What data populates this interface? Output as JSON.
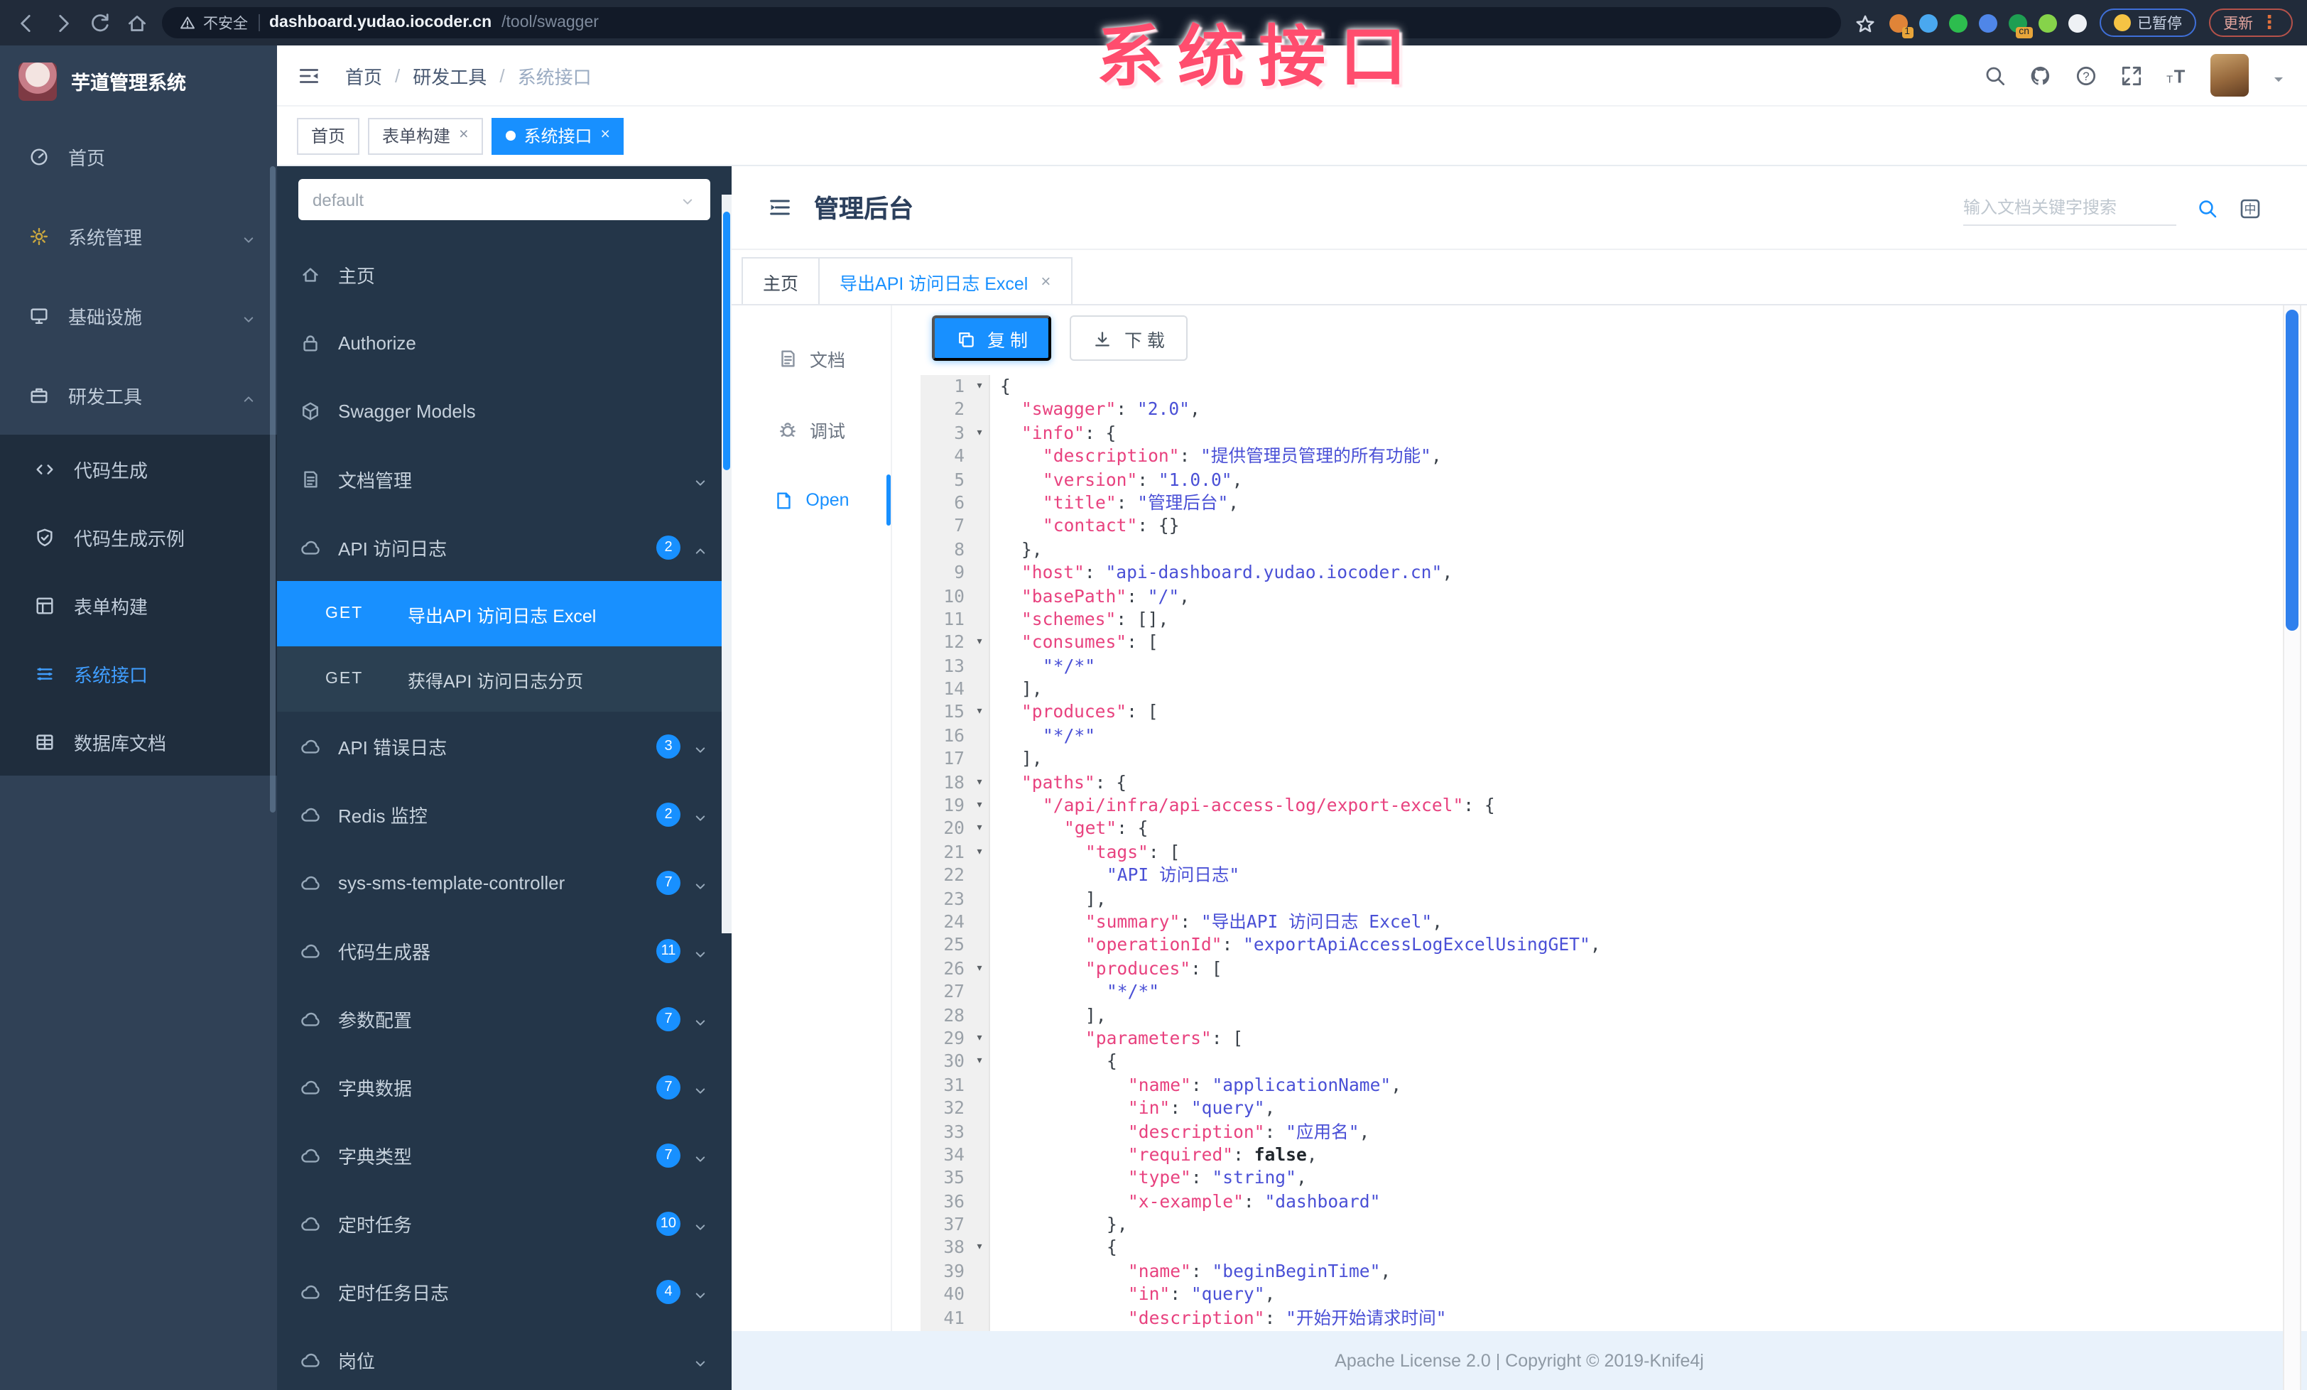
{
  "browser": {
    "security_label": "不安全",
    "url_host": "dashboard.yudao.iocoder.cn",
    "url_path": "/tool/swagger",
    "extensions": [
      {
        "color": "#e08438",
        "badge": "1"
      },
      {
        "color": "#4aa8ef",
        "badge": ""
      },
      {
        "color": "#2dbd4e",
        "badge": ""
      },
      {
        "color": "#4f86e8",
        "badge": ""
      },
      {
        "color": "#1e9e52",
        "badge": "cn"
      },
      {
        "color": "#86d34a",
        "badge": ""
      },
      {
        "color": "#eef1f5",
        "badge": ""
      }
    ],
    "paused_badge": "已暂停",
    "update_button": "更新",
    "overlay_title": "系统接口"
  },
  "app": {
    "logo_title": "芋道管理系统",
    "breadcrumb": [
      "首页",
      "研发工具",
      "系统接口"
    ],
    "sidebar_items": [
      {
        "icon": "dashboard",
        "label": "首页"
      },
      {
        "icon": "gear",
        "label": "系统管理",
        "chevron": "down",
        "icon_color": "#c9a63f"
      },
      {
        "icon": "infra",
        "label": "基础设施",
        "chevron": "down"
      },
      {
        "icon": "tool",
        "label": "研发工具",
        "chevron": "up",
        "expanded": true,
        "children": [
          {
            "icon": "code",
            "label": "代码生成"
          },
          {
            "icon": "shield",
            "label": "代码生成示例"
          },
          {
            "icon": "form",
            "label": "表单构建"
          },
          {
            "icon": "swagger",
            "label": "系统接口",
            "active": true
          },
          {
            "icon": "db",
            "label": "数据库文档"
          }
        ]
      }
    ],
    "tags": [
      {
        "label": "首页",
        "closable": false,
        "active": false
      },
      {
        "label": "表单构建",
        "closable": true,
        "active": false
      },
      {
        "label": "系统接口",
        "closable": true,
        "active": true
      }
    ]
  },
  "swagger_panel": {
    "group_select": "default",
    "items": [
      {
        "type": "link",
        "icon": "home",
        "label": "主页"
      },
      {
        "type": "link",
        "icon": "lock",
        "label": "Authorize"
      },
      {
        "type": "link",
        "icon": "cube",
        "label": "Swagger Models"
      },
      {
        "type": "group",
        "icon": "docfile",
        "label": "文档管理",
        "badge": "",
        "chevron": "down"
      },
      {
        "type": "group",
        "icon": "cloud",
        "label": "API 访问日志",
        "badge": "2",
        "chevron": "up",
        "expanded": true,
        "children": [
          {
            "method": "GET",
            "label": "导出API 访问日志 Excel",
            "active": true
          },
          {
            "method": "GET",
            "label": "获得API 访问日志分页",
            "active": false
          }
        ]
      },
      {
        "type": "group",
        "icon": "cloud",
        "label": "API 错误日志",
        "badge": "3",
        "chevron": "down"
      },
      {
        "type": "group",
        "icon": "cloud",
        "label": "Redis 监控",
        "badge": "2",
        "chevron": "down"
      },
      {
        "type": "group",
        "icon": "cloud",
        "label": "sys-sms-template-controller",
        "badge": "7",
        "chevron": "down"
      },
      {
        "type": "group",
        "icon": "cloud",
        "label": "代码生成器",
        "badge": "11",
        "chevron": "down"
      },
      {
        "type": "group",
        "icon": "cloud",
        "label": "参数配置",
        "badge": "7",
        "chevron": "down"
      },
      {
        "type": "group",
        "icon": "cloud",
        "label": "字典数据",
        "badge": "7",
        "chevron": "down"
      },
      {
        "type": "group",
        "icon": "cloud",
        "label": "字典类型",
        "badge": "7",
        "chevron": "down"
      },
      {
        "type": "group",
        "icon": "cloud",
        "label": "定时任务",
        "badge": "10",
        "chevron": "down"
      },
      {
        "type": "group",
        "icon": "cloud",
        "label": "定时任务日志",
        "badge": "4",
        "chevron": "down"
      },
      {
        "type": "group",
        "icon": "cloud",
        "label": "岗位",
        "badge": "",
        "chevron": "down"
      }
    ]
  },
  "content": {
    "title": "管理后台",
    "search_placeholder": "输入文档关键字搜索",
    "lang_label": "中",
    "doc_tabs": [
      {
        "label": "主页",
        "closable": false,
        "active": false
      },
      {
        "label": "导出API 访问日志 Excel",
        "closable": true,
        "active": true
      }
    ],
    "side_tabs": [
      {
        "icon": "docfile",
        "label": "文档",
        "active": false
      },
      {
        "icon": "bug",
        "label": "调试",
        "active": false
      },
      {
        "icon": "file",
        "label": "Open",
        "active": true
      }
    ],
    "copy_button": "复 制",
    "download_button": "下 载",
    "footer": "Apache License 2.0 | Copyright © 2019-Knife4j"
  },
  "code": {
    "lines": [
      {
        "n": 1,
        "fold": true,
        "ind": 0,
        "t": [
          [
            "p",
            "{"
          ]
        ]
      },
      {
        "n": 2,
        "fold": false,
        "ind": 1,
        "t": [
          [
            "k",
            "\"swagger\""
          ],
          [
            "p",
            ": "
          ],
          [
            "s",
            "\"2.0\""
          ],
          [
            "p",
            ","
          ]
        ]
      },
      {
        "n": 3,
        "fold": true,
        "ind": 1,
        "t": [
          [
            "k",
            "\"info\""
          ],
          [
            "p",
            ": {"
          ]
        ]
      },
      {
        "n": 4,
        "fold": false,
        "ind": 2,
        "t": [
          [
            "k",
            "\"description\""
          ],
          [
            "p",
            ": "
          ],
          [
            "s",
            "\"提供管理员管理的所有功能\""
          ],
          [
            "p",
            ","
          ]
        ]
      },
      {
        "n": 5,
        "fold": false,
        "ind": 2,
        "t": [
          [
            "k",
            "\"version\""
          ],
          [
            "p",
            ": "
          ],
          [
            "s",
            "\"1.0.0\""
          ],
          [
            "p",
            ","
          ]
        ]
      },
      {
        "n": 6,
        "fold": false,
        "ind": 2,
        "t": [
          [
            "k",
            "\"title\""
          ],
          [
            "p",
            ": "
          ],
          [
            "s",
            "\"管理后台\""
          ],
          [
            "p",
            ","
          ]
        ]
      },
      {
        "n": 7,
        "fold": false,
        "ind": 2,
        "t": [
          [
            "k",
            "\"contact\""
          ],
          [
            "p",
            ": {}"
          ]
        ]
      },
      {
        "n": 8,
        "fold": false,
        "ind": 1,
        "t": [
          [
            "p",
            "},"
          ]
        ]
      },
      {
        "n": 9,
        "fold": false,
        "ind": 1,
        "t": [
          [
            "k",
            "\"host\""
          ],
          [
            "p",
            ": "
          ],
          [
            "s",
            "\"api-dashboard.yudao.iocoder.cn\""
          ],
          [
            "p",
            ","
          ]
        ]
      },
      {
        "n": 10,
        "fold": false,
        "ind": 1,
        "t": [
          [
            "k",
            "\"basePath\""
          ],
          [
            "p",
            ": "
          ],
          [
            "s",
            "\"/\""
          ],
          [
            "p",
            ","
          ]
        ]
      },
      {
        "n": 11,
        "fold": false,
        "ind": 1,
        "t": [
          [
            "k",
            "\"schemes\""
          ],
          [
            "p",
            ": [],"
          ]
        ]
      },
      {
        "n": 12,
        "fold": true,
        "ind": 1,
        "t": [
          [
            "k",
            "\"consumes\""
          ],
          [
            "p",
            ": ["
          ]
        ]
      },
      {
        "n": 13,
        "fold": false,
        "ind": 2,
        "t": [
          [
            "s",
            "\"*/*\""
          ]
        ]
      },
      {
        "n": 14,
        "fold": false,
        "ind": 1,
        "t": [
          [
            "p",
            "],"
          ]
        ]
      },
      {
        "n": 15,
        "fold": true,
        "ind": 1,
        "t": [
          [
            "k",
            "\"produces\""
          ],
          [
            "p",
            ": ["
          ]
        ]
      },
      {
        "n": 16,
        "fold": false,
        "ind": 2,
        "t": [
          [
            "s",
            "\"*/*\""
          ]
        ]
      },
      {
        "n": 17,
        "fold": false,
        "ind": 1,
        "t": [
          [
            "p",
            "],"
          ]
        ]
      },
      {
        "n": 18,
        "fold": true,
        "ind": 1,
        "t": [
          [
            "k",
            "\"paths\""
          ],
          [
            "p",
            ": {"
          ]
        ]
      },
      {
        "n": 19,
        "fold": true,
        "ind": 2,
        "t": [
          [
            "k",
            "\"/api/infra/api-access-log/export-excel\""
          ],
          [
            "p",
            ": {"
          ]
        ]
      },
      {
        "n": 20,
        "fold": true,
        "ind": 3,
        "t": [
          [
            "k",
            "\"get\""
          ],
          [
            "p",
            ": {"
          ]
        ]
      },
      {
        "n": 21,
        "fold": true,
        "ind": 4,
        "t": [
          [
            "k",
            "\"tags\""
          ],
          [
            "p",
            ": ["
          ]
        ]
      },
      {
        "n": 22,
        "fold": false,
        "ind": 5,
        "t": [
          [
            "s",
            "\"API 访问日志\""
          ]
        ]
      },
      {
        "n": 23,
        "fold": false,
        "ind": 4,
        "t": [
          [
            "p",
            "],"
          ]
        ]
      },
      {
        "n": 24,
        "fold": false,
        "ind": 4,
        "t": [
          [
            "k",
            "\"summary\""
          ],
          [
            "p",
            ": "
          ],
          [
            "s",
            "\"导出API 访问日志 Excel\""
          ],
          [
            "p",
            ","
          ]
        ]
      },
      {
        "n": 25,
        "fold": false,
        "ind": 4,
        "t": [
          [
            "k",
            "\"operationId\""
          ],
          [
            "p",
            ": "
          ],
          [
            "s",
            "\"exportApiAccessLogExcelUsingGET\""
          ],
          [
            "p",
            ","
          ]
        ]
      },
      {
        "n": 26,
        "fold": true,
        "ind": 4,
        "t": [
          [
            "k",
            "\"produces\""
          ],
          [
            "p",
            ": ["
          ]
        ]
      },
      {
        "n": 27,
        "fold": false,
        "ind": 5,
        "t": [
          [
            "s",
            "\"*/*\""
          ]
        ]
      },
      {
        "n": 28,
        "fold": false,
        "ind": 4,
        "t": [
          [
            "p",
            "],"
          ]
        ]
      },
      {
        "n": 29,
        "fold": true,
        "ind": 4,
        "t": [
          [
            "k",
            "\"parameters\""
          ],
          [
            "p",
            ": ["
          ]
        ]
      },
      {
        "n": 30,
        "fold": true,
        "ind": 5,
        "t": [
          [
            "p",
            "{"
          ]
        ]
      },
      {
        "n": 31,
        "fold": false,
        "ind": 6,
        "t": [
          [
            "k",
            "\"name\""
          ],
          [
            "p",
            ": "
          ],
          [
            "s",
            "\"applicationName\""
          ],
          [
            "p",
            ","
          ]
        ]
      },
      {
        "n": 32,
        "fold": false,
        "ind": 6,
        "t": [
          [
            "k",
            "\"in\""
          ],
          [
            "p",
            ": "
          ],
          [
            "s",
            "\"query\""
          ],
          [
            "p",
            ","
          ]
        ]
      },
      {
        "n": 33,
        "fold": false,
        "ind": 6,
        "t": [
          [
            "k",
            "\"description\""
          ],
          [
            "p",
            ": "
          ],
          [
            "s",
            "\"应用名\""
          ],
          [
            "p",
            ","
          ]
        ]
      },
      {
        "n": 34,
        "fold": false,
        "ind": 6,
        "t": [
          [
            "k",
            "\"required\""
          ],
          [
            "p",
            ": "
          ],
          [
            "b",
            "false"
          ],
          [
            "p",
            ","
          ]
        ]
      },
      {
        "n": 35,
        "fold": false,
        "ind": 6,
        "t": [
          [
            "k",
            "\"type\""
          ],
          [
            "p",
            ": "
          ],
          [
            "s",
            "\"string\""
          ],
          [
            "p",
            ","
          ]
        ]
      },
      {
        "n": 36,
        "fold": false,
        "ind": 6,
        "t": [
          [
            "k",
            "\"x-example\""
          ],
          [
            "p",
            ": "
          ],
          [
            "s",
            "\"dashboard\""
          ]
        ]
      },
      {
        "n": 37,
        "fold": false,
        "ind": 5,
        "t": [
          [
            "p",
            "},"
          ]
        ]
      },
      {
        "n": 38,
        "fold": true,
        "ind": 5,
        "t": [
          [
            "p",
            "{"
          ]
        ]
      },
      {
        "n": 39,
        "fold": false,
        "ind": 6,
        "t": [
          [
            "k",
            "\"name\""
          ],
          [
            "p",
            ": "
          ],
          [
            "s",
            "\"beginBeginTime\""
          ],
          [
            "p",
            ","
          ]
        ]
      },
      {
        "n": 40,
        "fold": false,
        "ind": 6,
        "t": [
          [
            "k",
            "\"in\""
          ],
          [
            "p",
            ": "
          ],
          [
            "s",
            "\"query\""
          ],
          [
            "p",
            ","
          ]
        ]
      },
      {
        "n": 41,
        "fold": false,
        "ind": 6,
        "t": [
          [
            "k",
            "\"description\""
          ],
          [
            "p",
            ": "
          ],
          [
            "s",
            "\"开始开始请求时间\""
          ]
        ]
      }
    ]
  }
}
